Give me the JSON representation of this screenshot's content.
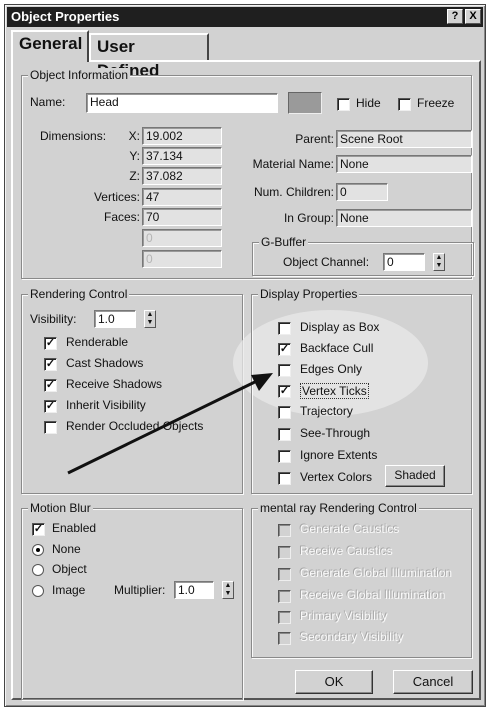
{
  "window": {
    "title": "Object Properties",
    "help_glyph": "?",
    "close_glyph": "X"
  },
  "tabs": [
    {
      "label": "General"
    },
    {
      "label": "User Defined"
    }
  ],
  "object_information": {
    "legend": "Object Information",
    "name_label": "Name:",
    "name_value": "Head",
    "hide_label": "Hide",
    "freeze_label": "Freeze",
    "dimensions_label": "Dimensions:",
    "x_label": "X:",
    "x_value": "19.002",
    "y_label": "Y:",
    "y_value": "37.134",
    "z_label": "Z:",
    "z_value": "37.082",
    "vertices_label": "Vertices:",
    "vertices_value": "47",
    "faces_label": "Faces:",
    "faces_value": "70",
    "extra1_value": "0",
    "extra2_value": "0",
    "parent_label": "Parent:",
    "parent_value": "Scene Root",
    "material_label": "Material Name:",
    "material_value": "None",
    "children_label": "Num. Children:",
    "children_value": "0",
    "group_label": "In Group:",
    "group_value": "None",
    "gbuffer_legend": "G-Buffer",
    "channel_label": "Object Channel:",
    "channel_value": "0"
  },
  "rendering_control": {
    "legend": "Rendering Control",
    "visibility_label": "Visibility:",
    "visibility_value": "1.0",
    "items": [
      {
        "label": "Renderable",
        "checked": true
      },
      {
        "label": "Cast Shadows",
        "checked": true
      },
      {
        "label": "Receive Shadows",
        "checked": true
      },
      {
        "label": "Inherit Visibility",
        "checked": true
      },
      {
        "label": "Render Occluded Objects",
        "checked": false
      }
    ]
  },
  "display_properties": {
    "legend": "Display Properties",
    "items": [
      {
        "label": "Display as Box",
        "checked": false
      },
      {
        "label": "Backface Cull",
        "checked": true
      },
      {
        "label": "Edges Only",
        "checked": false
      },
      {
        "label": "Vertex Ticks",
        "checked": true
      },
      {
        "label": "Trajectory",
        "checked": false
      },
      {
        "label": "See-Through",
        "checked": false
      },
      {
        "label": "Ignore Extents",
        "checked": false
      },
      {
        "label": "Vertex Colors",
        "checked": false
      }
    ],
    "shaded_button": "Shaded"
  },
  "motion_blur": {
    "legend": "Motion Blur",
    "enabled_label": "Enabled",
    "none_label": "None",
    "object_label": "Object",
    "image_label": "Image",
    "multiplier_label": "Multiplier:",
    "multiplier_value": "1.0"
  },
  "mental_ray": {
    "legend": "mental ray Rendering Control",
    "items": [
      {
        "label": "Generate Caustics"
      },
      {
        "label": "Receive Caustics"
      },
      {
        "label": "Generate Global Illumination"
      },
      {
        "label": "Receive Global Illumination"
      },
      {
        "label": "Primary Visibility"
      },
      {
        "label": "Secondary Visibility"
      }
    ]
  },
  "buttons": {
    "ok": "OK",
    "cancel": "Cancel"
  }
}
